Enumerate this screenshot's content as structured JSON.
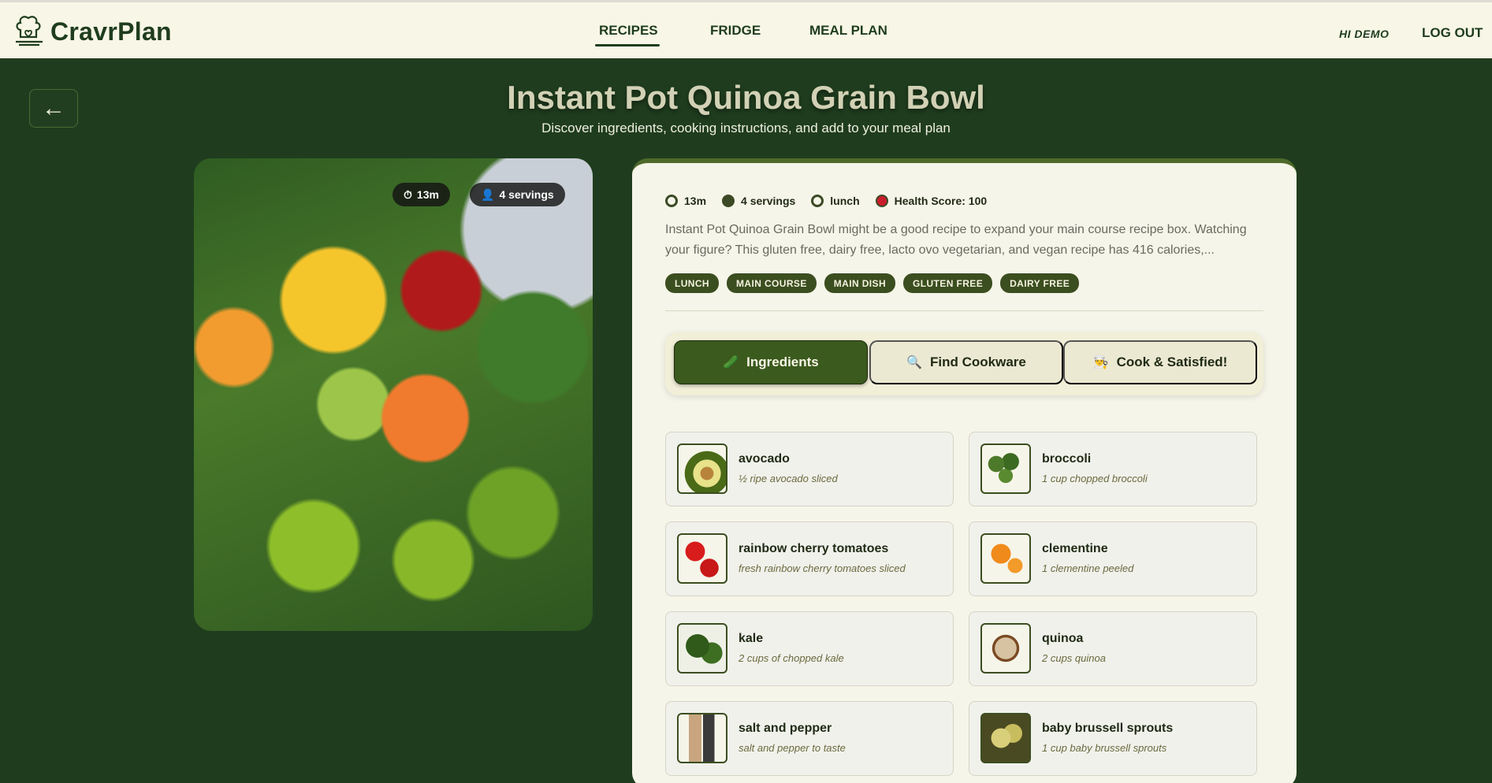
{
  "header": {
    "logo_text": "CravrPlan",
    "nav": [
      {
        "label": "RECIPES",
        "active": true
      },
      {
        "label": "FRIDGE",
        "active": false
      },
      {
        "label": "MEAL PLAN",
        "active": false
      }
    ],
    "greeting": "HI DEMO",
    "logout_label": "LOG OUT"
  },
  "hero": {
    "back_icon": "←",
    "title": "Instant Pot Quinoa Grain Bowl",
    "subtitle": "Discover ingredients, cooking instructions, and add to your meal plan"
  },
  "image_badges": {
    "time": "13m",
    "servings": "4 servings"
  },
  "recipe": {
    "meta": {
      "time": "13m",
      "servings": "4 servings",
      "meal_type": "lunch",
      "health": "Health Score: 100"
    },
    "description": "Instant Pot Quinoa Grain Bowl might be a good recipe to expand your main course recipe box. Watching your figure? This gluten free, dairy free, lacto ovo vegetarian, and vegan recipe has 416 calories,...",
    "tags": [
      "LUNCH",
      "MAIN COURSE",
      "MAIN DISH",
      "GLUTEN FREE",
      "DAIRY FREE"
    ]
  },
  "tabs": [
    {
      "label": "Ingredients",
      "icon": "🥒",
      "active": true
    },
    {
      "label": "Find Cookware",
      "icon": "🔍",
      "active": false
    },
    {
      "label": "Cook & Satisfied!",
      "icon": "👨‍🍳",
      "active": false
    }
  ],
  "ingredients": [
    {
      "name": "avocado",
      "qty": "½ ripe avocado sliced",
      "thumb": "avocado"
    },
    {
      "name": "broccoli",
      "qty": "1 cup chopped broccoli",
      "thumb": "broccoli"
    },
    {
      "name": "rainbow cherry tomatoes",
      "qty": "fresh rainbow cherry tomatoes sliced",
      "thumb": "tomato"
    },
    {
      "name": "clementine",
      "qty": "1 clementine peeled",
      "thumb": "clementine"
    },
    {
      "name": "kale",
      "qty": "2 cups of chopped kale",
      "thumb": "kale"
    },
    {
      "name": "quinoa",
      "qty": "2 cups quinoa",
      "thumb": "quinoa"
    },
    {
      "name": "salt and pepper",
      "qty": "salt and pepper to taste",
      "thumb": "salt"
    },
    {
      "name": "baby brussell sprouts",
      "qty": "1 cup baby brussell sprouts",
      "thumb": "sprouts"
    }
  ]
}
